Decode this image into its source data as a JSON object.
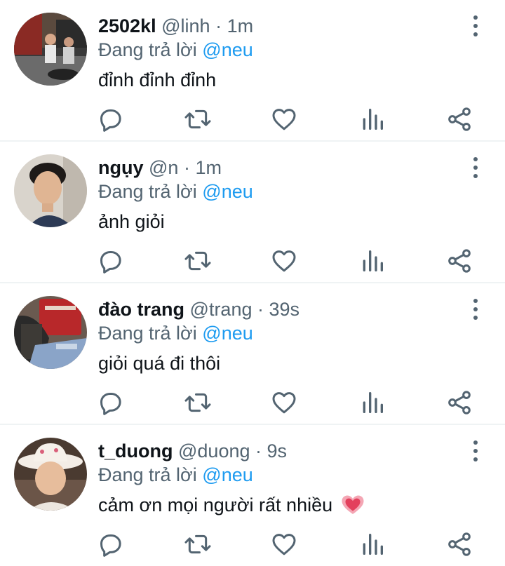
{
  "reply_prefix": "Đang trả lời",
  "tweets": [
    {
      "name": "2502kl",
      "handle": "@linh",
      "separator": "·",
      "time": "1m",
      "mention": "@neu",
      "text": "đỉnh đỉnh đỉnh",
      "avatar": "avatar-street-photo"
    },
    {
      "name": "ngụy",
      "handle": "@n",
      "separator": "·",
      "time": "1m",
      "mention": "@neu",
      "text": "ảnh giỏi",
      "avatar": "avatar-selfie"
    },
    {
      "name": "đào trang",
      "handle": "@trang",
      "separator": "·",
      "time": "39s",
      "mention": "@neu",
      "text": "giỏi quá đi thôi",
      "avatar": "avatar-bag-photo"
    },
    {
      "name": "t_duong",
      "handle": "@duong",
      "separator": "·",
      "time": "9s",
      "mention": "@neu",
      "text": "cảm ơn mọi người rất nhiều",
      "text_emoji": "heart-emoji",
      "avatar": "avatar-cowboy-hat"
    }
  ],
  "icons": {
    "reply": "reply-icon",
    "retweet": "retweet-icon",
    "like": "heart-icon",
    "views": "analytics-icon",
    "share": "share-icon",
    "more": "more-vertical-icon"
  },
  "colors": {
    "text": "#0f1419",
    "secondary": "#536471",
    "accent": "#1d9bf0",
    "divider": "#eff3f4"
  }
}
